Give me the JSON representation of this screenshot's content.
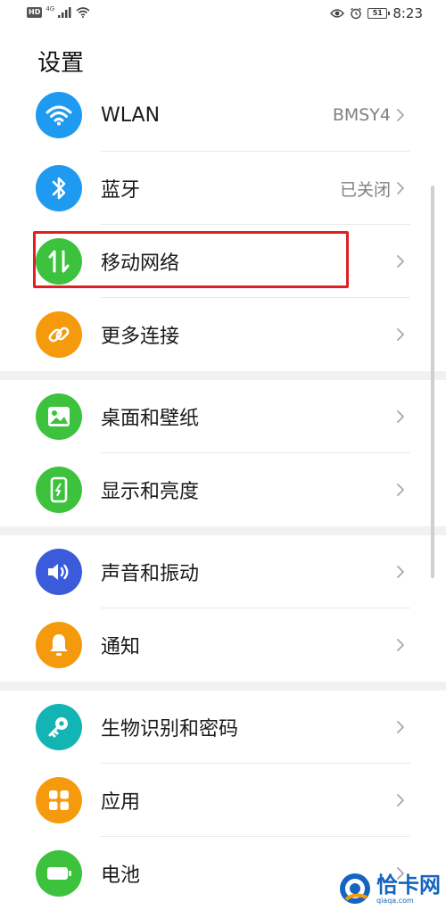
{
  "status_bar": {
    "hd": "HD",
    "net_type": "4G",
    "battery": "51",
    "time": "8:23"
  },
  "page_title": "设置",
  "groups": [
    {
      "items": [
        {
          "id": "wlan",
          "label": "WLAN",
          "value": "BMSY4",
          "icon": "wifi-icon",
          "color": "#1e9bf0"
        },
        {
          "id": "bluetooth",
          "label": "蓝牙",
          "value": "已关闭",
          "icon": "bluetooth-icon",
          "color": "#1e9bf0"
        },
        {
          "id": "mobile-network",
          "label": "移动网络",
          "value": "",
          "icon": "mobile-data-icon",
          "color": "#3cc23c"
        },
        {
          "id": "more-connections",
          "label": "更多连接",
          "value": "",
          "icon": "link-icon",
          "color": "#f59a0c"
        }
      ]
    },
    {
      "items": [
        {
          "id": "home-wallpaper",
          "label": "桌面和壁纸",
          "value": "",
          "icon": "image-icon",
          "color": "#3cc23c"
        },
        {
          "id": "display-brightness",
          "label": "显示和亮度",
          "value": "",
          "icon": "phone-brightness-icon",
          "color": "#3cc23c"
        }
      ]
    },
    {
      "items": [
        {
          "id": "sound-vibration",
          "label": "声音和振动",
          "value": "",
          "icon": "speaker-icon",
          "color": "#3b5bdb"
        },
        {
          "id": "notifications",
          "label": "通知",
          "value": "",
          "icon": "bell-icon",
          "color": "#f59a0c"
        }
      ]
    },
    {
      "items": [
        {
          "id": "biometrics-password",
          "label": "生物识别和密码",
          "value": "",
          "icon": "key-icon",
          "color": "#13b4b4"
        },
        {
          "id": "apps",
          "label": "应用",
          "value": "",
          "icon": "apps-grid-icon",
          "color": "#f59a0c"
        },
        {
          "id": "battery",
          "label": "电池",
          "value": "",
          "icon": "battery-icon",
          "color": "#3cc23c"
        }
      ]
    }
  ],
  "watermark": {
    "text": "恰卡网",
    "url": "qiaqa.com"
  },
  "colors": {
    "highlight": "#e02020",
    "watermark": "#1565c0"
  }
}
